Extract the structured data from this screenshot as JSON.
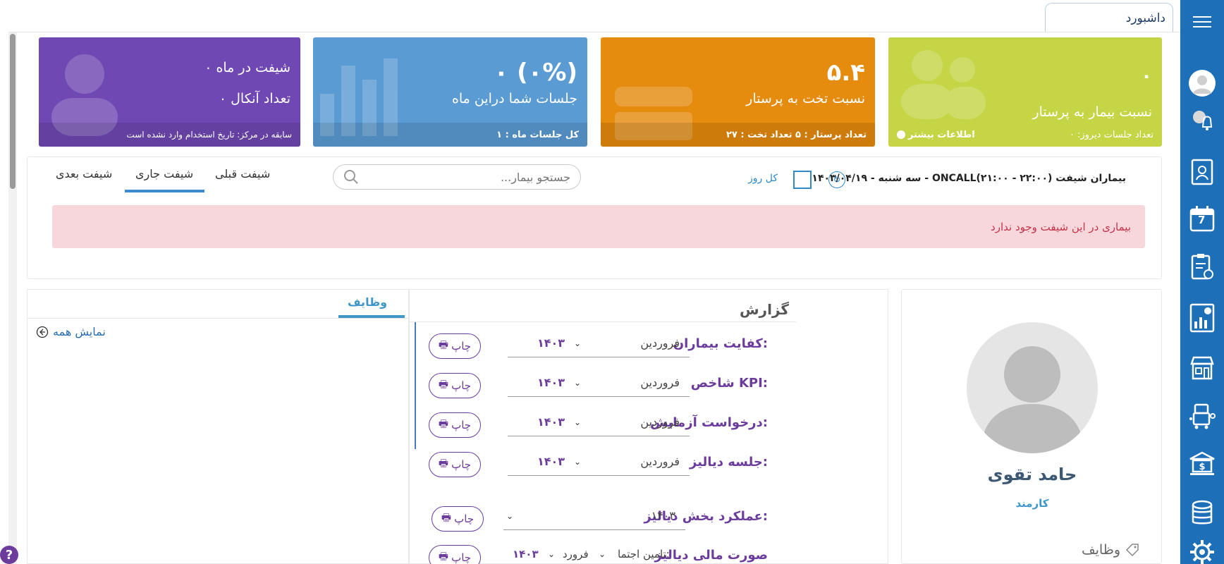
{
  "window": {
    "tab_label": "داشبورد"
  },
  "colors": {
    "sidebar": "#1d6fb8",
    "purple": "#6b3c9c",
    "blue_accent": "#3f97c9"
  },
  "sidebar": {
    "icons": [
      "menu-icon",
      "user-avatar",
      "notification-bell-icon",
      "id-card-icon",
      "calendar-icon",
      "clipboard-clock-icon",
      "report-chart-icon",
      "store-icon",
      "dialysis-machine-icon",
      "bank-dollar-icon",
      "database-icon",
      "settings-icon"
    ],
    "calendar_day": "7"
  },
  "cards": {
    "patient_ratio": {
      "value": "۰",
      "title": "نسبت بیمار به پرستار",
      "footer_right": "تعداد جلسات دیروز: ۰",
      "footer_left": "اطلاعات بیشتر"
    },
    "bed_ratio": {
      "value": "۵.۴",
      "title": "نسبت تخت به پرستار",
      "footer": "تعداد پرستار : ۵ تعداد تخت : ۲۷"
    },
    "sessions": {
      "value": "۰ (۰%)",
      "title": "جلسات شما دراین ماه",
      "footer": "کل جلسات ماه : ۱"
    },
    "shifts": {
      "line1": "۰  شیفت در ماه",
      "line2": "۰  تعداد آنکال",
      "footer": "سابقه در مرکز: تاریخ استخدام وارد نشده است"
    }
  },
  "patients": {
    "title": "بیماران شیفت ONCALL(۲۱:۰۰ - ۲۲:۰۰) - سه شنبه - ۱۴۰۳/۰۴/۱۹",
    "all_day_label": "کل روز",
    "search_placeholder": "جستجو بیمار...",
    "tabs": {
      "prev": "شیفت قبلی",
      "current": "شیفت جاری",
      "next": "شیفت بعدی"
    },
    "empty_message": "بیماری در این شیفت وجود ندارد"
  },
  "profile": {
    "name": "حامد تقوی",
    "role": "کارمند",
    "tasks_label": "وظایف"
  },
  "report": {
    "title": "گزارش",
    "print_label": "چاپ",
    "rows": [
      {
        "label": "کفایت بیماران:",
        "month": "فروردین",
        "year": "۱۴۰۳"
      },
      {
        "label": "شاخص KPI:",
        "month": "فروردین",
        "year": "۱۴۰۳"
      },
      {
        "label": "درخواست آزمایش:",
        "month": "فروردین",
        "year": "۱۴۰۳"
      },
      {
        "label": "جلسه دیالیز:",
        "month": "فروردین",
        "year": "۱۴۰۳"
      }
    ],
    "dept_label": "عملکرد بخش دیالیز:",
    "dept_year": "۱۴۰۳",
    "finance_label": "صورت مالی دیالیز",
    "finance_source": "تامین اجتما:",
    "finance_month": "فرورد",
    "finance_year": "۱۴۰۳"
  },
  "tasks": {
    "tab_label": "وظایف",
    "show_all": "نمایش همه"
  },
  "help": {
    "label": "?"
  }
}
